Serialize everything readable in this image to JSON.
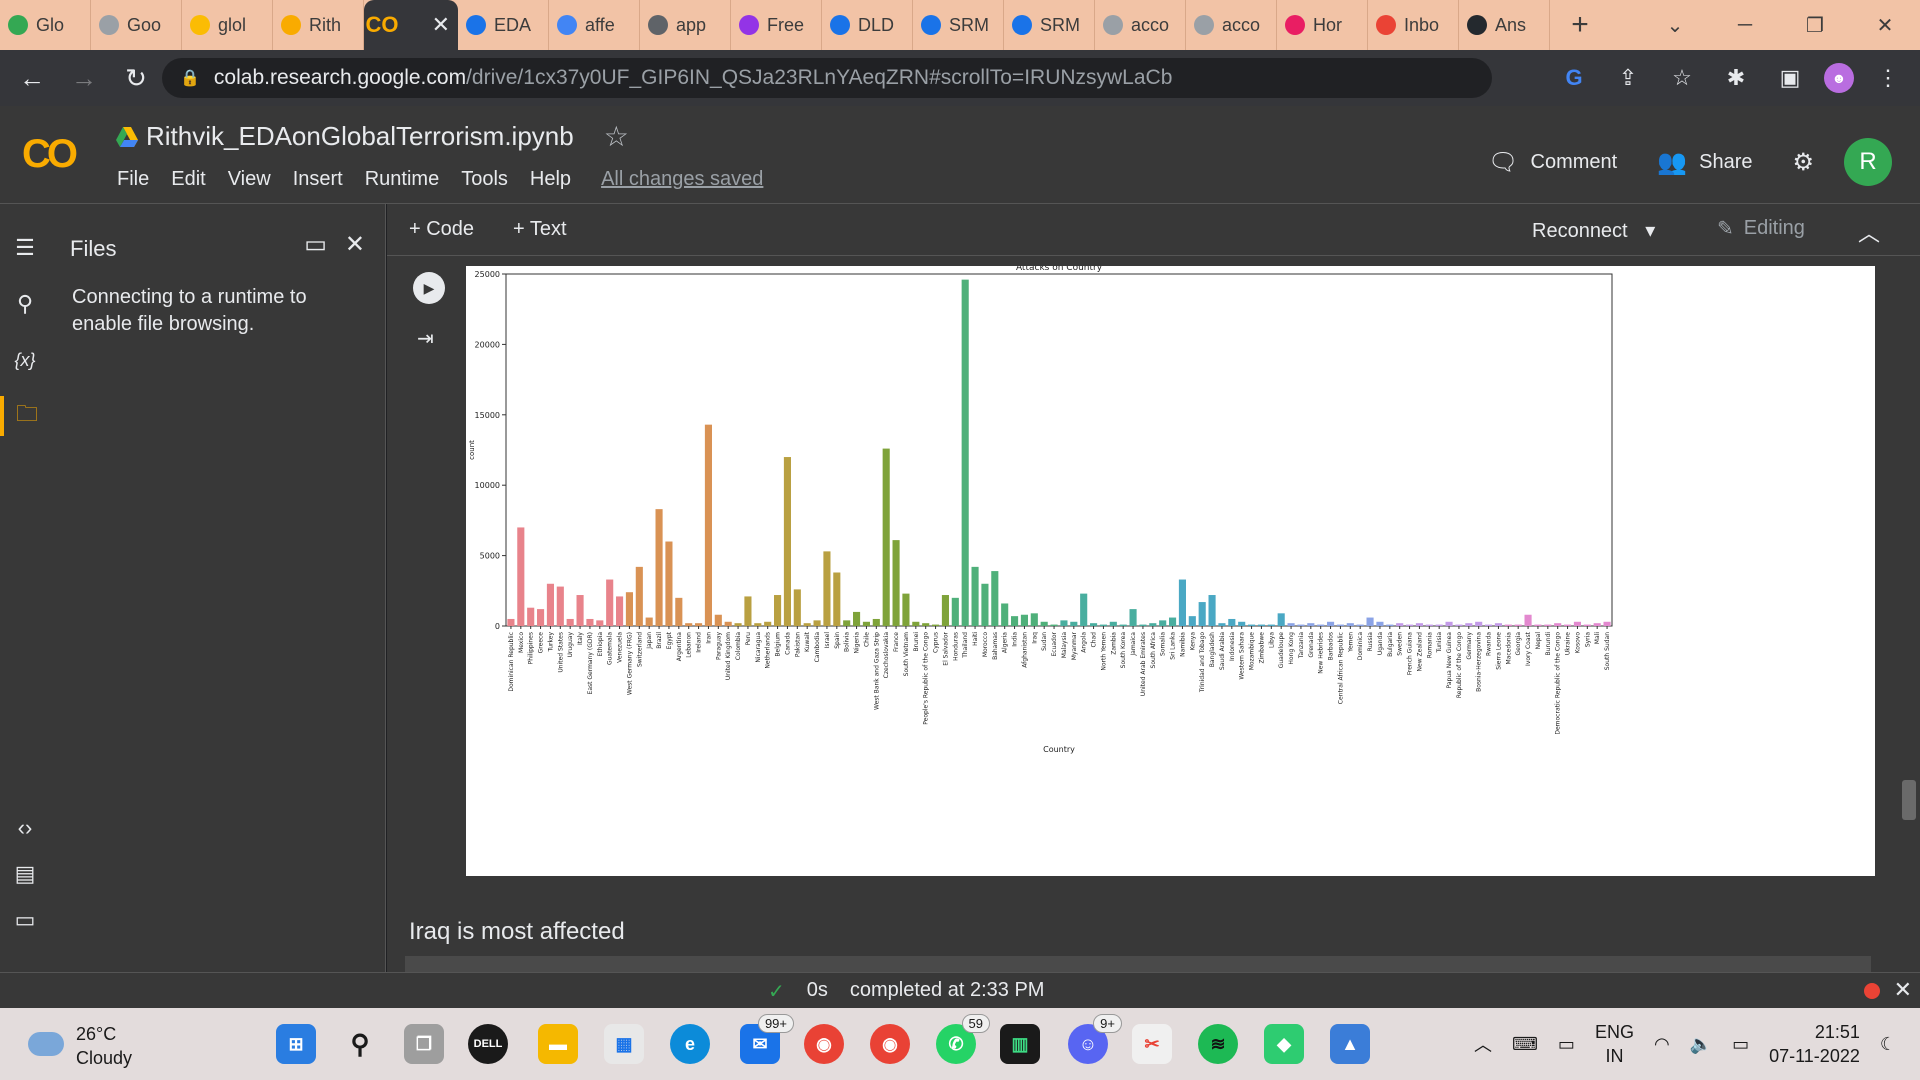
{
  "browser": {
    "tabs": [
      {
        "label": "Glo",
        "color": "#34a853"
      },
      {
        "label": "Goo",
        "color": "#9aa0a6"
      },
      {
        "label": "glol",
        "color": "#fbbc04"
      },
      {
        "label": "Rith",
        "color": "#f9ab00"
      },
      {
        "label": "",
        "color": "#f9ab00",
        "active": true
      },
      {
        "label": "EDA",
        "color": "#1a73e8"
      },
      {
        "label": "affe",
        "color": "#4285f4"
      },
      {
        "label": "app",
        "color": "#5f6368"
      },
      {
        "label": "Free",
        "color": "#9334e6"
      },
      {
        "label": "DLD",
        "color": "#1a73e8"
      },
      {
        "label": "SRM",
        "color": "#1a73e8"
      },
      {
        "label": "SRM",
        "color": "#1a73e8"
      },
      {
        "label": "acco",
        "color": "#9aa0a6"
      },
      {
        "label": "acco",
        "color": "#9aa0a6"
      },
      {
        "label": "Hor",
        "color": "#e91e63"
      },
      {
        "label": "Inbo",
        "color": "#ea4335"
      },
      {
        "label": "Ans",
        "color": "#24292e"
      }
    ],
    "active_tab_logo": "CO",
    "url_host": "colab.research.google.com",
    "url_path": "/drive/1cx37y0UF_GIP6IN_QSJa23RLnYAeqZRN#scrollTo=IRUNzsywLaCb"
  },
  "colab": {
    "logo": "CO",
    "notebook_title": "Rithvik_EDAonGlobalTerrorism.ipynb",
    "menu": [
      "File",
      "Edit",
      "View",
      "Insert",
      "Runtime",
      "Tools",
      "Help"
    ],
    "save_status": "All changes saved",
    "comment_label": "Comment",
    "share_label": "Share",
    "avatar_letter": "R"
  },
  "files_panel": {
    "title": "Files",
    "message": "Connecting to a runtime to enable file browsing."
  },
  "nb_toolbar": {
    "add_code": "+ Code",
    "add_text": "+ Text",
    "reconnect": "Reconnect",
    "editing": "Editing"
  },
  "markdown_text": "Iraq is most affected",
  "status": {
    "time": "0s",
    "message": "completed at 2:33 PM"
  },
  "taskbar": {
    "temp": "26°C",
    "condition": "Cloudy",
    "badges": {
      "mail": "99+",
      "whatsapp": "59",
      "discord": "9+"
    },
    "lang_top": "ENG",
    "lang_bottom": "IN",
    "time": "21:51",
    "date": "07-11-2022"
  },
  "chart_data": {
    "type": "bar",
    "title": "Attacks on Country",
    "xlabel": "Country",
    "ylabel": "count",
    "ylim": [
      0,
      25000
    ],
    "yticks": [
      0,
      5000,
      10000,
      15000,
      20000,
      25000
    ],
    "grid": false,
    "legend": "none",
    "categories": [
      "Dominican Republic",
      "Mexico",
      "Philippines",
      "Greece",
      "Turkey",
      "United States",
      "Uruguay",
      "Italy",
      "East Germany (GDR)",
      "Ethiopia",
      "Guatemala",
      "Venezuela",
      "West Germany (FRG)",
      "Switzerland",
      "Japan",
      "Brazil",
      "Egypt",
      "Argentina",
      "Lebanon",
      "Ireland",
      "Iran",
      "Paraguay",
      "United Kingdom",
      "Colombia",
      "Peru",
      "Nicaragua",
      "Netherlands",
      "Belgium",
      "Canada",
      "Pakistan",
      "Kuwait",
      "Cambodia",
      "Israel",
      "Spain",
      "Bolivia",
      "Nigeria",
      "Chile",
      "West Bank and Gaza Strip",
      "Czechoslovakia",
      "France",
      "South Vietnam",
      "Brunei",
      "People's Republic of the Congo",
      "Cyprus",
      "El Salvador",
      "Honduras",
      "Thailand",
      "Haiti",
      "Morocco",
      "Bahamas",
      "Algeria",
      "India",
      "Afghanistan",
      "Iraq",
      "Sudan",
      "Ecuador",
      "Malaysia",
      "Myanmar",
      "Angola",
      "Chad",
      "North Yemen",
      "Zambia",
      "South Korea",
      "Jamaica",
      "United Arab Emirates",
      "South Africa",
      "Somalia",
      "Sri Lanka",
      "Namibia",
      "Kenya",
      "Trinidad and Tobago",
      "Bangladesh",
      "Saudi Arabia",
      "Indonesia",
      "Western Sahara",
      "Mozambique",
      "Zimbabwe",
      "Libya",
      "Guadeloupe",
      "Hong Kong",
      "Tanzania",
      "Grenada",
      "New Hebrides",
      "Barbados",
      "Central African Republic",
      "Yemen",
      "Dominica",
      "Russia",
      "Uganda",
      "Bulgaria",
      "Sweden",
      "French Guiana",
      "New Zealand",
      "Romania",
      "Tunisia",
      "Papua New Guinea",
      "Republic of the Congo",
      "Germany",
      "Bosnia-Herzegovina",
      "Rwanda",
      "Sierra Leone",
      "Macedonia",
      "Georgia",
      "Ivory Coast",
      "Nepal",
      "Burundi",
      "Democratic Republic of the Congo",
      "Ukraine",
      "Kosovo",
      "Syria",
      "Mali",
      "South Sudan"
    ],
    "values": [
      500,
      7000,
      1300,
      1200,
      3000,
      2800,
      500,
      2200,
      500,
      400,
      3300,
      2100,
      2400,
      4200,
      600,
      8300,
      6000,
      2000,
      200,
      200,
      14300,
      800,
      300,
      200,
      2100,
      200,
      300,
      2200,
      12000,
      2600,
      200,
      400,
      5300,
      3800,
      400,
      1000,
      300,
      500,
      12600,
      6100,
      2300,
      300,
      200,
      100,
      2200,
      2000,
      24600,
      4200,
      3000,
      3900,
      1600,
      700,
      800,
      900,
      300,
      100,
      400,
      300,
      2300,
      200,
      100,
      300,
      100,
      1200,
      100,
      200,
      400,
      600,
      3300,
      700,
      1700,
      2200,
      200,
      500,
      300,
      100,
      100,
      100,
      900,
      200,
      100,
      200,
      100,
      300,
      100,
      200,
      100,
      600,
      300,
      100,
      200,
      100,
      200,
      100,
      100,
      300,
      100,
      200,
      300,
      100,
      200,
      100,
      100,
      800,
      100,
      100,
      200,
      100,
      300,
      100,
      200,
      300
    ],
    "series_colors": [
      "#e8838b",
      "#d99254",
      "#b9a041",
      "#7fa33a",
      "#4fb07a",
      "#49ae9f",
      "#4aa8c4",
      "#8ba3e6",
      "#c39ae8",
      "#e389cf"
    ]
  }
}
